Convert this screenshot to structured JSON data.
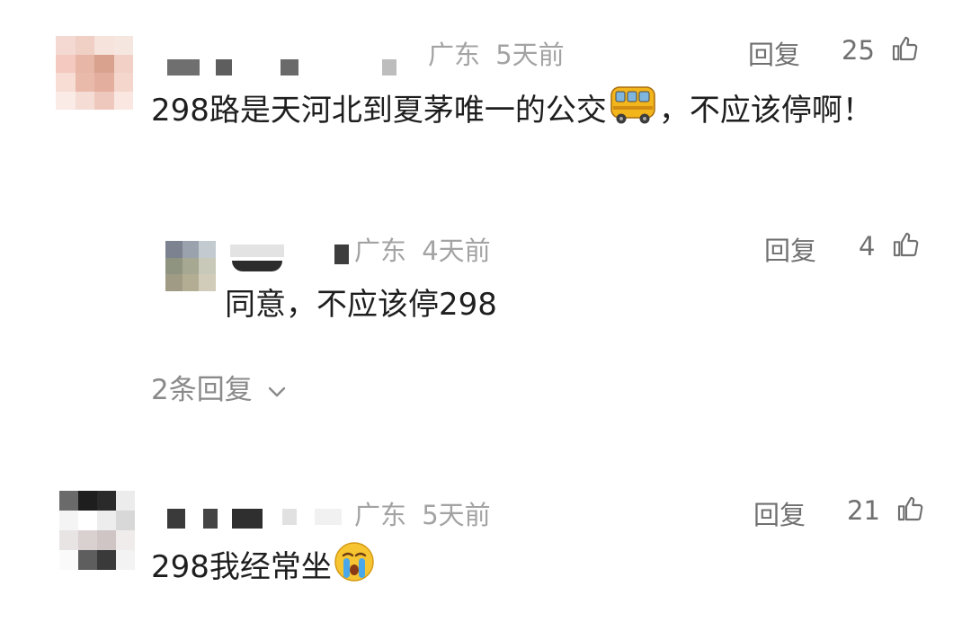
{
  "comments": [
    {
      "region": "广东",
      "time": "5天前",
      "reply_label": "回复",
      "likes": "25",
      "text_main": "298路是天河北到夏茅唯一的公交",
      "text_after_emoji": "，不应该停啊！",
      "emoji": "bus-icon",
      "sub_replies": [
        {
          "region": "广东",
          "time": "4天前",
          "reply_label": "回复",
          "likes": "4",
          "text": "同意，不应该停298"
        }
      ],
      "more_replies": "2条回复"
    },
    {
      "region": "广东",
      "time": "5天前",
      "reply_label": "回复",
      "likes": "21",
      "text_main": "298我经常坐",
      "emoji": "crying-face-icon"
    }
  ],
  "colors": {
    "meta": "#a3a3a3",
    "text": "#1e1e1e",
    "action": "#707070"
  }
}
